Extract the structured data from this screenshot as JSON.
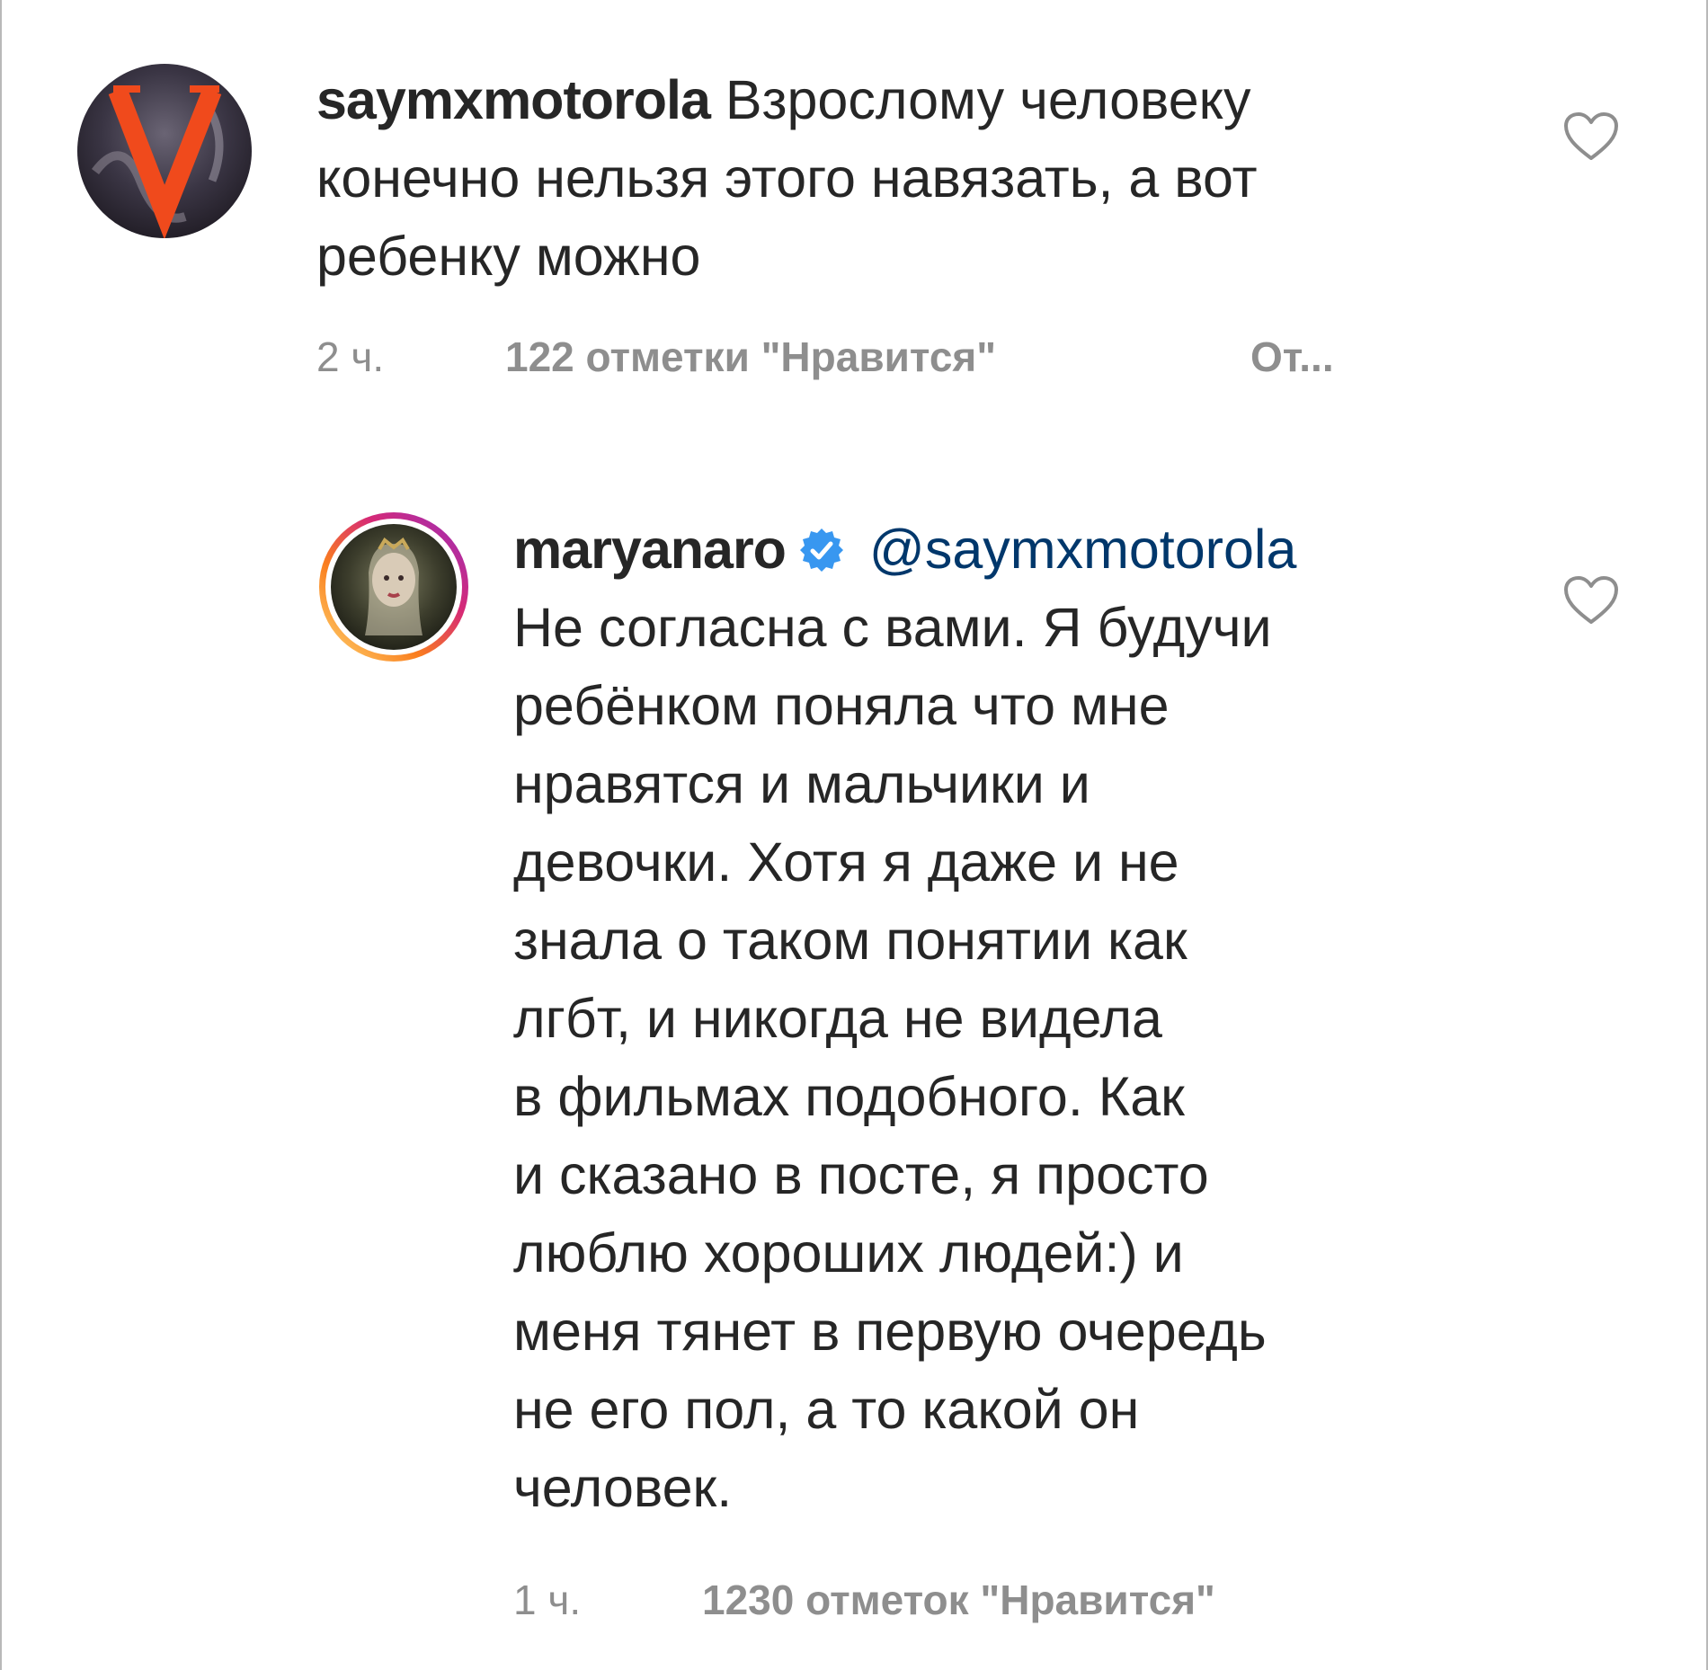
{
  "comments": [
    {
      "username": "saymxmotorola",
      "text": "Взрослому человеку\nконечно нельзя этого навязать, а вот\nребенку можно",
      "time": "2 ч.",
      "likes": "122 отметки \"Нравится\"",
      "reply": "От..."
    },
    {
      "username": "maryanaro",
      "verified": true,
      "mention": "@saymxmotorola",
      "text": "Не согласна с вами. Я будучи\nребёнком поняла что мне\nнравятся и мальчики и\nдевочки. Хотя я даже и не\nзнала о таком понятии как\nлгбт, и никогда не видела\nв фильмах подобного. Как\nи сказано в посте, я просто\nлюблю хороших людей:) и\nменя тянет в первую очередь\nне его пол, а то какой он\nчеловек.",
      "time": "1 ч.",
      "likes": "1230 отметок \"Нравится\""
    }
  ],
  "icons": {
    "like": "heart-outline-icon",
    "verified": "verified-badge-icon"
  },
  "colors": {
    "text": "#262626",
    "meta": "#8e8e8e",
    "mention": "#00376b",
    "verified": "#3897f0"
  }
}
